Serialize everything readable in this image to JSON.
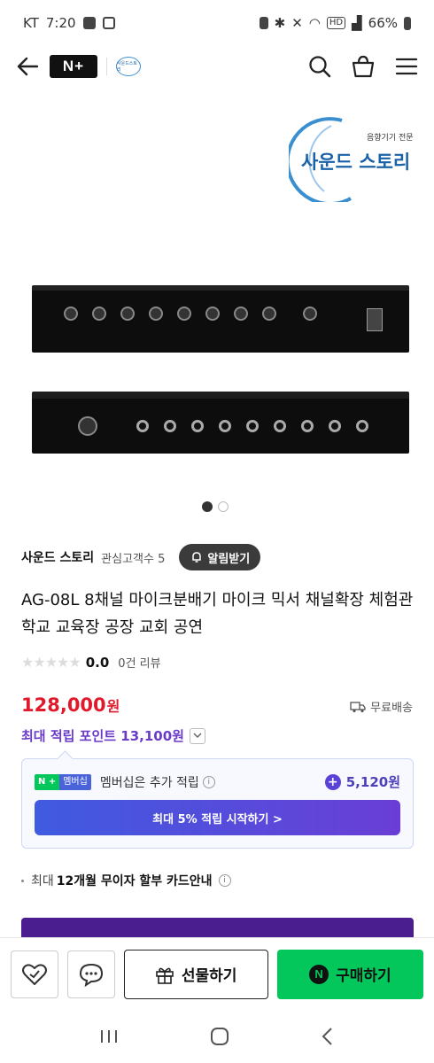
{
  "status_bar": {
    "carrier": "KT",
    "time": "7:20",
    "hd_label": "HD",
    "battery": "66%"
  },
  "app_bar": {
    "nplus_logo": "N+",
    "mini_logo_text": "사운드스토리",
    "icons": [
      "back-arrow-icon",
      "search-icon",
      "cart-icon",
      "menu-icon"
    ]
  },
  "hero": {
    "brand_logo_tagline": "음향기기 전문",
    "brand_logo_name": "사운드 스토리",
    "carousel_dots": 2,
    "active_dot": 0
  },
  "store": {
    "name": "사운드 스토리",
    "followers_label": "관심고객수 5",
    "alarm_button": "알림받기"
  },
  "product": {
    "title": "AG-08L 8채널 마이크분배기 마이크 믹서 채널확장 체험관 학교 교육장 공장 교회 공연",
    "rating_stars": "★★★★★",
    "rating": "0.0",
    "reviews": "0건 리뷰",
    "price": "128,000",
    "price_unit": "원",
    "shipping": "무료배송",
    "points": "최대 적립 포인트 13,100원"
  },
  "membership": {
    "badge_n": "N +",
    "badge_label": "멤버십",
    "text": "멤버십은 추가 적립",
    "info_icon": "i",
    "extra_points": "5,120원",
    "cta": "최대 5% 적립 시작하기 >"
  },
  "installment": {
    "prefix": "최대",
    "highlight": "12개월 무이자 할부 카드안내",
    "info_icon": "i"
  },
  "bottom_actions": {
    "gift_label": "선물하기",
    "buy_label": "구매하기",
    "buy_logo": "N"
  },
  "colors": {
    "price_red": "#e11a2b",
    "points_purple": "#6b3bc7",
    "naver_green": "#03c75a",
    "membership_blue": "#4a63d9"
  }
}
